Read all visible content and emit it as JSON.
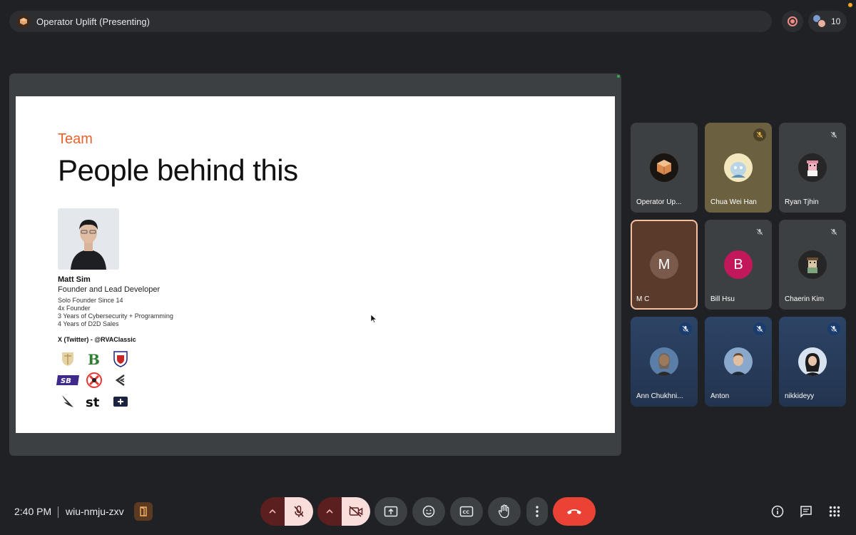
{
  "meeting": {
    "title": "Operator Uplift (Presenting)",
    "participant_count": "10",
    "time": "2:40 PM",
    "code": "wiu-nmju-zxv"
  },
  "slide": {
    "eyebrow": "Team",
    "heading": "People behind this",
    "person_name": "Matt Sim",
    "person_role": "Founder and Lead Developer",
    "facts": [
      "Solo Founder Since 14",
      "4x Founder",
      "3 Years of Cybersecurity + Programming",
      "4 Years of D2D Sales"
    ],
    "twitter": "X (Twitter) - @RVAClassic"
  },
  "participants": [
    {
      "name": "Operator Up...",
      "avatar": "cube-logo-icon",
      "muted": false
    },
    {
      "name": "Chua Wei Han",
      "avatar": "cartoon-avatar",
      "muted": true
    },
    {
      "name": "Ryan Tjhin",
      "avatar": "pixel-avatar",
      "muted": true
    },
    {
      "name": "M C",
      "letter": "M",
      "muted": false,
      "speaking": true
    },
    {
      "name": "Bill Hsu",
      "letter": "B",
      "muted": true
    },
    {
      "name": "Chaerin Kim",
      "avatar": "pixel-avatar",
      "muted": true
    },
    {
      "name": "Ann Chukhni...",
      "avatar": "photo",
      "muted": true
    },
    {
      "name": "Anton",
      "avatar": "photo",
      "muted": true
    },
    {
      "name": "nikkideyy",
      "avatar": "photo",
      "muted": true
    }
  ],
  "colors": {
    "accent_orange": "#e8622c",
    "end_call_red": "#ea4335",
    "speaking_border": "#f6c0a0",
    "bill_avatar": "#c2185b"
  }
}
